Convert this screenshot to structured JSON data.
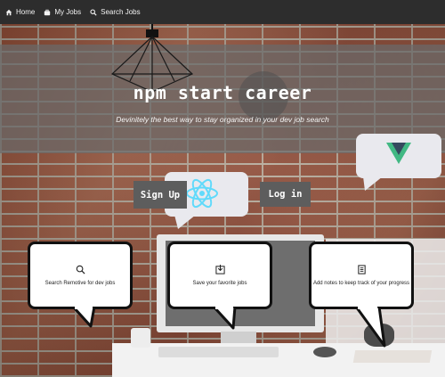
{
  "nav": {
    "items": [
      {
        "label": "Home",
        "icon": "home-icon"
      },
      {
        "label": "My Jobs",
        "icon": "briefcase-icon"
      },
      {
        "label": "Search Jobs",
        "icon": "search-icon"
      }
    ]
  },
  "hero": {
    "title": "npm start career",
    "subtitle": "Devinitely the best way to stay organized in your dev job search"
  },
  "auth": {
    "signup_label": "Sign Up",
    "login_label": "Log in"
  },
  "features": [
    {
      "icon": "search-icon",
      "text": "Search Remotive for dev jobs"
    },
    {
      "icon": "save-icon",
      "text": "Save your favorite jobs"
    },
    {
      "icon": "notes-icon",
      "text": "Add notes to keep track of your progress"
    }
  ],
  "colors": {
    "navbar": "#2d2d2d",
    "banner_overlay": "#696969",
    "button": "#5d5d5d",
    "react_logo": "#61dafb",
    "vue_green": "#41b883",
    "vue_dark": "#35495e"
  }
}
